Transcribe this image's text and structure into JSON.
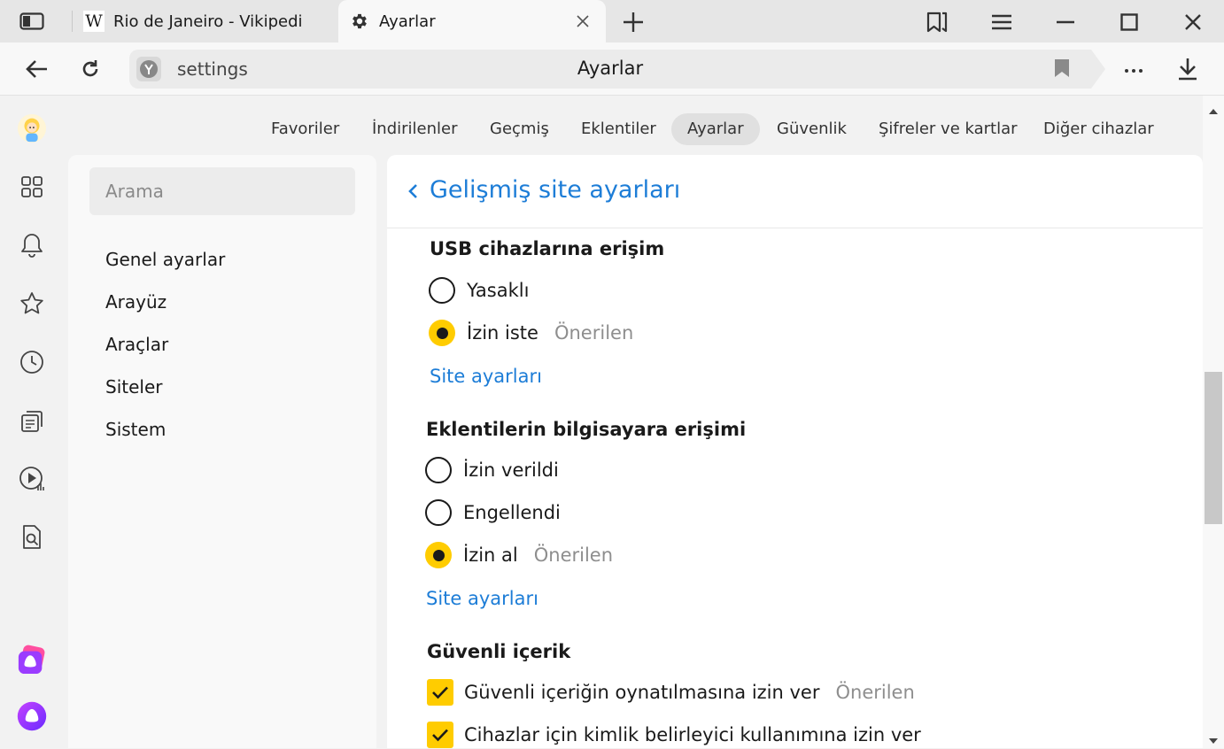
{
  "tabs": [
    {
      "title": "Rio de Janeiro - Vikipedi",
      "favicon": "W"
    },
    {
      "title": "Ayarlar",
      "favicon": "gear-icon"
    }
  ],
  "address": {
    "url": "settings",
    "title": "Ayarlar"
  },
  "topnav": [
    "Favoriler",
    "İndirilenler",
    "Geçmiş",
    "Eklentiler",
    "Ayarlar",
    "Güvenlik",
    "Şifreler ve kartlar",
    "Diğer cihazlar"
  ],
  "search": {
    "placeholder": "Arama"
  },
  "leftnav": [
    "Genel ayarlar",
    "Arayüz",
    "Araçlar",
    "Siteler",
    "Sistem"
  ],
  "page": {
    "title": "Gelişmiş site ayarları",
    "sections": [
      {
        "title": "USB cihazlarına erişim",
        "options": [
          "Yasaklı",
          "İzin iste"
        ],
        "selected": "İzin iste",
        "link": "Site ayarları"
      },
      {
        "title": "Eklentilerin bilgisayara erişimi",
        "options": [
          "İzin verildi",
          "Engellendi",
          "İzin al"
        ],
        "selected": "İzin al",
        "link": "Site ayarları"
      },
      {
        "title": "Güvenli içerik",
        "checks": [
          "Güvenli içeriğin oynatılmasına izin ver",
          "Cihazlar için kimlik belirleyici kullanımına izin ver"
        ]
      }
    ],
    "recommended": "Önerilen"
  },
  "colors": {
    "accent": "#1d7dd7",
    "control": "#ffcc00"
  }
}
